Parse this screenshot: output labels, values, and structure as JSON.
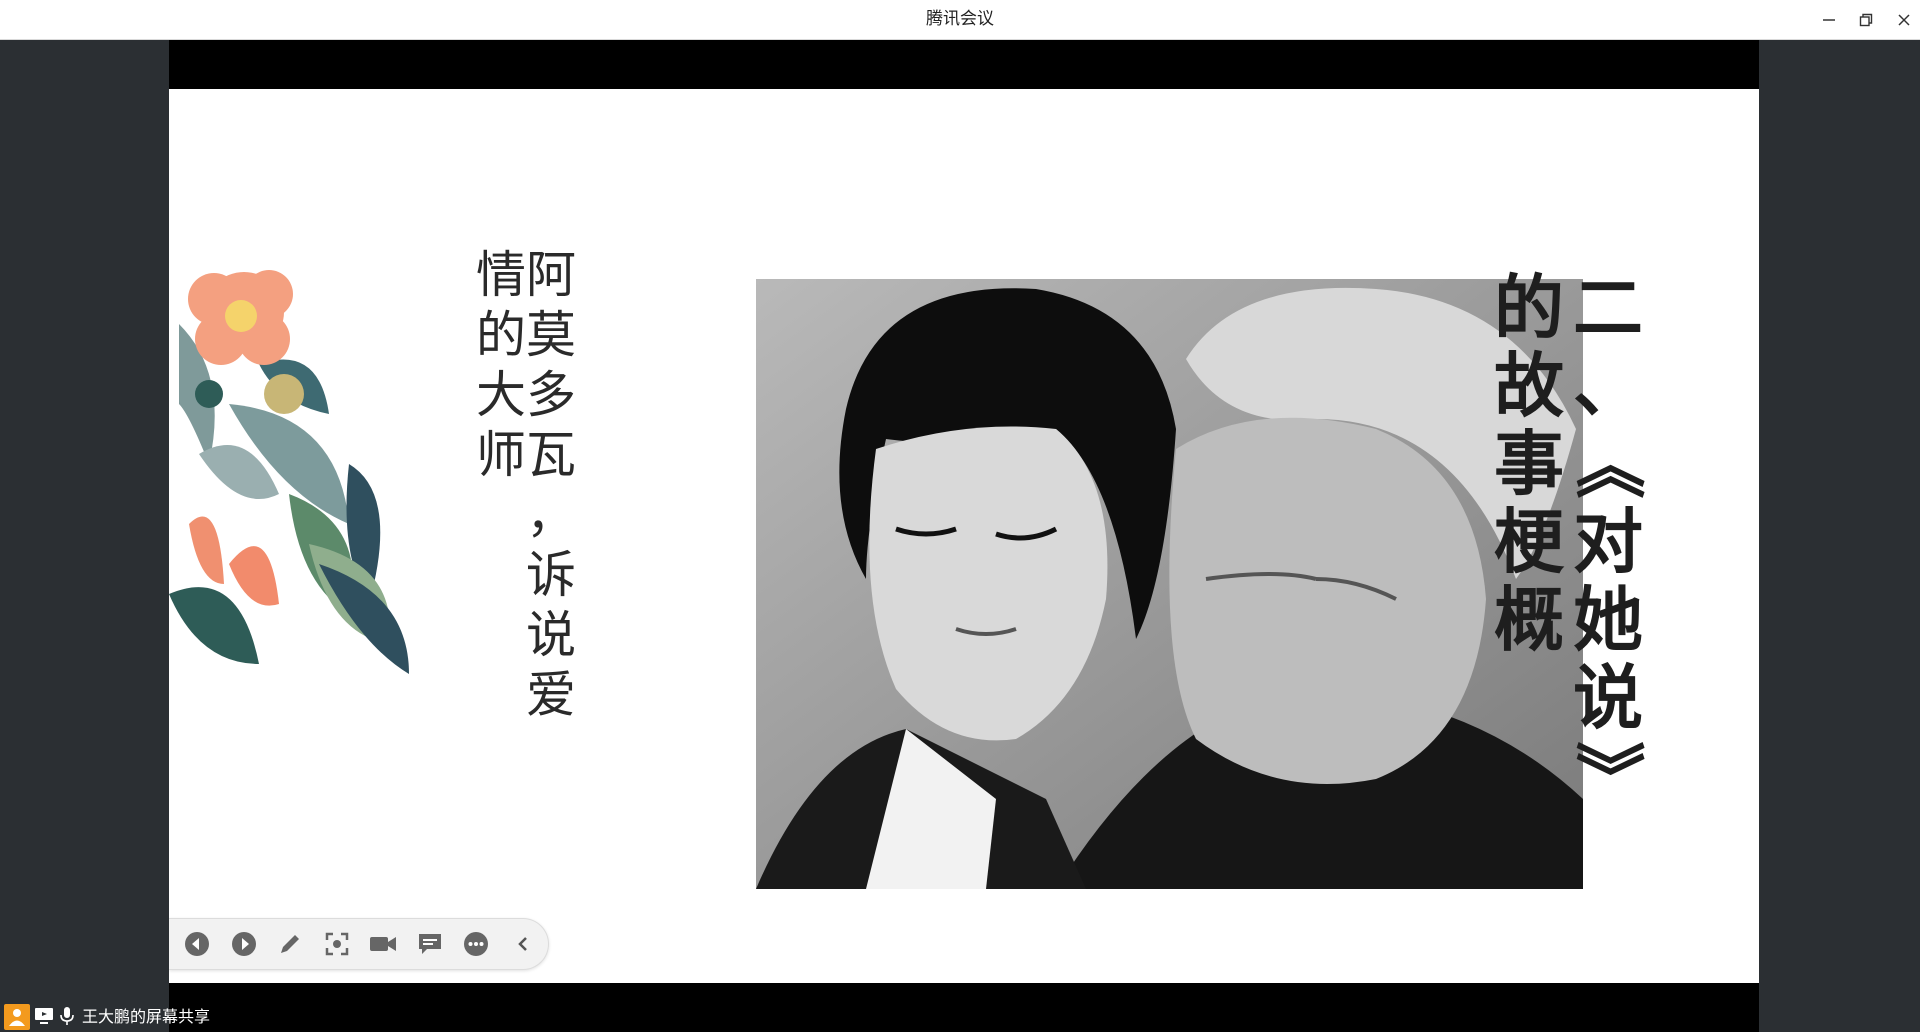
{
  "window": {
    "title": "腾讯会议",
    "controls": [
      "minimize-icon",
      "restore-icon",
      "close-icon"
    ]
  },
  "slide": {
    "left_text_columns": [
      [
        "阿",
        "莫",
        "多",
        "瓦",
        "，",
        "诉",
        "说",
        "爱"
      ],
      [
        "情",
        "的",
        "大",
        "师"
      ]
    ],
    "right_text_columns": [
      [
        "二",
        "、",
        "《",
        "对",
        "她",
        "说",
        "》"
      ],
      [
        "的",
        "故",
        "事",
        "梗",
        "概"
      ]
    ],
    "photo": "black-and-white portrait photograph"
  },
  "toolbar": {
    "buttons": [
      {
        "name": "previous-slide-button",
        "icon": "circle-left-arrow-icon"
      },
      {
        "name": "next-slide-button",
        "icon": "circle-right-arrow-icon"
      },
      {
        "name": "annotate-pen-button",
        "icon": "pen-icon"
      },
      {
        "name": "screenshot-button",
        "icon": "capture-frame-icon"
      },
      {
        "name": "camera-button",
        "icon": "video-camera-icon"
      },
      {
        "name": "chat-button",
        "icon": "chat-bubble-icon"
      },
      {
        "name": "more-button",
        "icon": "ellipsis-circle-icon"
      },
      {
        "name": "collapse-toolbar-button",
        "icon": "chevron-left-icon"
      }
    ]
  },
  "statusbar": {
    "share_label": "王大鹏的屏幕共享",
    "icons": [
      "user-icon",
      "screen-share-icon",
      "microphone-icon"
    ]
  },
  "colors": {
    "accent_orange": "#f39a1e",
    "chrome_dark": "#2b2f33",
    "slide_bg": "#ffffff"
  }
}
